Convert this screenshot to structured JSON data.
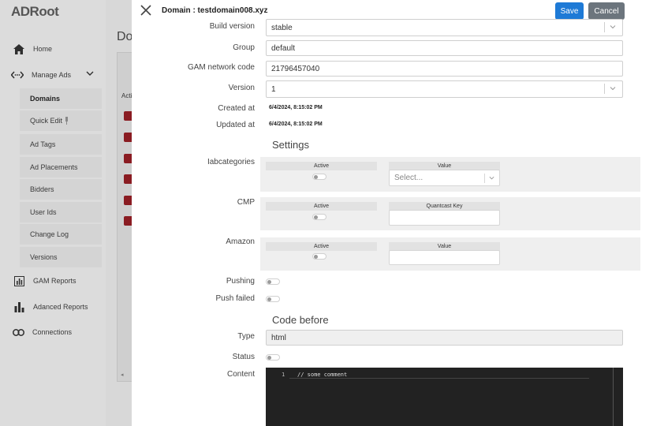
{
  "app": {
    "logo": "ADRoot"
  },
  "sidebar": {
    "home": "Home",
    "manage_ads": "Manage Ads",
    "sub_items": [
      "Domains",
      "Quick Edit",
      "Ad Tags",
      "Ad Placements",
      "Bidders",
      "User Ids",
      "Change Log",
      "Versions"
    ],
    "gam_reports": "GAM Reports",
    "advanced_reports": "Adanced Reports",
    "connections": "Connections"
  },
  "background": {
    "page_heading": "Dom",
    "table_header": "Acti"
  },
  "modal": {
    "title": "Domain : testdomain008.xyz",
    "save_label": "Save",
    "cancel_label": "Cancel",
    "fields": {
      "build_version": {
        "label": "Build version",
        "value": "stable"
      },
      "group": {
        "label": "Group",
        "value": "default"
      },
      "gam_network_code": {
        "label": "GAM network code",
        "value": "21796457040"
      },
      "version": {
        "label": "Version",
        "value": "1"
      },
      "created_at": {
        "label": "Created at",
        "value": "6/4/2024, 8:15:02 PM"
      },
      "updated_at": {
        "label": "Updated at",
        "value": "6/4/2024, 8:15:02 PM"
      }
    },
    "settings": {
      "heading": "Settings",
      "iabcategories": {
        "label": "Iabcategories",
        "active_header": "Active",
        "value_header": "Value",
        "placeholder": "Select..."
      },
      "cmp": {
        "label": "CMP",
        "active_header": "Active",
        "value_header": "Quantcast Key"
      },
      "amazon": {
        "label": "Amazon",
        "active_header": "Active",
        "value_header": "Value"
      },
      "pushing": {
        "label": "Pushing"
      },
      "push_failed": {
        "label": "Push failed"
      }
    },
    "code_before": {
      "heading": "Code before",
      "type": {
        "label": "Type",
        "value": "html"
      },
      "status": {
        "label": "Status"
      },
      "content": {
        "label": "Content",
        "line_number": "1",
        "code": "// some comment"
      }
    }
  }
}
